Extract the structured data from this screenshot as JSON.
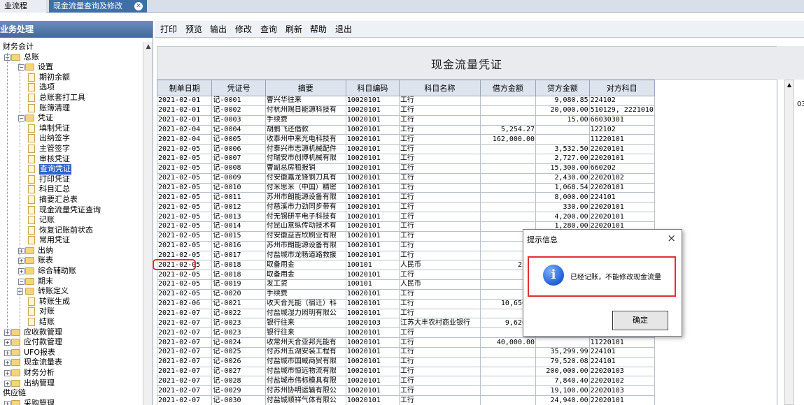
{
  "tabs": [
    {
      "label": "业流程"
    },
    {
      "label": "现金流量查询及修改"
    }
  ],
  "left_panel": {
    "title": "业务处理",
    "tree": [
      {
        "label": "财务会计",
        "level": 0,
        "kind": "text"
      },
      {
        "label": "总账",
        "level": 1,
        "kind": "folder",
        "pm": "-"
      },
      {
        "label": "设置",
        "level": 2,
        "kind": "folder",
        "pm": "-"
      },
      {
        "label": "期初余额",
        "level": 3,
        "kind": "doc"
      },
      {
        "label": "选项",
        "level": 3,
        "kind": "doc"
      },
      {
        "label": "总账套打工具",
        "level": 3,
        "kind": "doc"
      },
      {
        "label": "账簿清理",
        "level": 3,
        "kind": "doc"
      },
      {
        "label": "凭证",
        "level": 2,
        "kind": "folder",
        "pm": "-"
      },
      {
        "label": "填制凭证",
        "level": 3,
        "kind": "doc"
      },
      {
        "label": "出纳签字",
        "level": 3,
        "kind": "doc"
      },
      {
        "label": "主管签字",
        "level": 3,
        "kind": "doc"
      },
      {
        "label": "审核凭证",
        "level": 3,
        "kind": "doc"
      },
      {
        "label": "查询凭证",
        "level": 3,
        "kind": "doc",
        "selected": true
      },
      {
        "label": "打印凭证",
        "level": 3,
        "kind": "doc"
      },
      {
        "label": "科目汇总",
        "level": 3,
        "kind": "doc"
      },
      {
        "label": "摘要汇总表",
        "level": 3,
        "kind": "doc"
      },
      {
        "label": "现金流量凭证查询",
        "level": 3,
        "kind": "doc"
      },
      {
        "label": "记账",
        "level": 3,
        "kind": "doc"
      },
      {
        "label": "恢复记账前状态",
        "level": 3,
        "kind": "doc"
      },
      {
        "label": "常用凭证",
        "level": 3,
        "kind": "doc"
      },
      {
        "label": "出纳",
        "level": 2,
        "kind": "folder",
        "pm": "+"
      },
      {
        "label": "账表",
        "level": 2,
        "kind": "folder",
        "pm": "+"
      },
      {
        "label": "综合辅助账",
        "level": 2,
        "kind": "folder",
        "pm": "+"
      },
      {
        "label": "期末",
        "level": 2,
        "kind": "folder",
        "pm": "-"
      },
      {
        "label": "转账定义",
        "level": 3,
        "kind": "folder",
        "pm": "+"
      },
      {
        "label": "转账生成",
        "level": 3,
        "kind": "doc"
      },
      {
        "label": "对账",
        "level": 3,
        "kind": "doc"
      },
      {
        "label": "结账",
        "level": 3,
        "kind": "doc"
      },
      {
        "label": "应收款管理",
        "level": 1,
        "kind": "folder",
        "pm": "+"
      },
      {
        "label": "应付款管理",
        "level": 1,
        "kind": "folder",
        "pm": "+"
      },
      {
        "label": "UFO报表",
        "level": 1,
        "kind": "folder",
        "pm": "+"
      },
      {
        "label": "现金流量表",
        "level": 1,
        "kind": "folder",
        "pm": "+"
      },
      {
        "label": "财务分析",
        "level": 1,
        "kind": "folder",
        "pm": "+"
      },
      {
        "label": "出纳管理",
        "level": 1,
        "kind": "folder",
        "pm": "+"
      },
      {
        "label": "供应链",
        "level": 0,
        "kind": "text"
      },
      {
        "label": "采购管理",
        "level": 1,
        "kind": "folder",
        "pm": "+"
      }
    ]
  },
  "toolbar": [
    {
      "label": "打印"
    },
    {
      "label": "预览"
    },
    {
      "label": "输出"
    },
    {
      "label": "修改"
    },
    {
      "label": "查询"
    },
    {
      "label": "刷新"
    },
    {
      "label": "帮助"
    },
    {
      "label": "退出"
    }
  ],
  "document": {
    "title": "现金流量凭证"
  },
  "table": {
    "columns": [
      "制单日期",
      "凭证号",
      "摘要",
      "科目编码",
      "科目名称",
      "借方金额",
      "贷方金额",
      "对方科目"
    ],
    "rows": [
      [
        "2021-02-01",
        "记-0001",
        "曹兴华往来",
        "10020101",
        "工行",
        "",
        "9,080.85",
        "224102"
      ],
      [
        "2021-02-01",
        "记-0002",
        "付杭州赐日能源科技有",
        "10020101",
        "工行",
        "",
        "20,000.00",
        "510129, 2221010"
      ],
      [
        "2021-02-01",
        "记-0003",
        "手续费",
        "10020101",
        "工行",
        "",
        "15.00",
        "66030301"
      ],
      [
        "2021-02-04",
        "记-0004",
        "胡鹏飞还借款",
        "10020101",
        "工行",
        "5,254.27",
        "",
        "122102"
      ],
      [
        "2021-02-04",
        "记-0005",
        "收泰州中来光电科技有",
        "10020101",
        "工行",
        "162,000.00",
        "",
        "11220101"
      ],
      [
        "2021-02-05",
        "记-0006",
        "付泰兴市志源机械配件",
        "10020101",
        "工行",
        "",
        "3,532.50",
        "22020101"
      ],
      [
        "2021-02-05",
        "记-0007",
        "付瑞安市创博机械有限",
        "10020101",
        "工行",
        "",
        "2,727.00",
        "22020101"
      ],
      [
        "2021-02-05",
        "记-0008",
        "曹副总房租报销",
        "10020101",
        "工行",
        "",
        "15,300.00",
        "660202"
      ],
      [
        "2021-02-05",
        "记-0009",
        "付安徽嘉龙锋钢刀具有",
        "10020101",
        "工行",
        "",
        "2,430.00",
        "22020102"
      ],
      [
        "2021-02-05",
        "记-0010",
        "付米思米（中国）精密",
        "10020101",
        "工行",
        "",
        "1,068.54",
        "22020101"
      ],
      [
        "2021-02-05",
        "记-0011",
        "苏州市朗能源设备有限",
        "10020101",
        "工行",
        "",
        "8,000.00",
        "224101"
      ],
      [
        "2021-02-05",
        "记-0012",
        "付慈溪市力劲同步带有",
        "10020101",
        "工行",
        "",
        "330.00",
        "22020101"
      ],
      [
        "2021-02-05",
        "记-0013",
        "付无锡研平电子科技有",
        "10020101",
        "工行",
        "",
        "4,200.00",
        "22020101"
      ],
      [
        "2021-02-05",
        "记-0014",
        "付昆山意纵传动技术有",
        "10020101",
        "工行",
        "",
        "1,280.00",
        "22020101"
      ],
      [
        "2021-02-05",
        "记-0015",
        "付安徽益吉欣刷业有限",
        "10020101",
        "工行",
        "",
        "",
        ""
      ],
      [
        "2021-02-05",
        "记-0016",
        "苏州市朗能源设备有限",
        "10020101",
        "工行",
        "",
        "",
        ""
      ],
      [
        "2021-02-05",
        "记-0017",
        "付盐城市龙畅道路救援",
        "10020101",
        "工行",
        "",
        "",
        ""
      ],
      [
        "2021-02-05",
        "记-0018",
        "取备用金",
        "100101",
        "人民币",
        "25,0",
        "",
        ""
      ],
      [
        "2021-02-05",
        "记-0018",
        "取备用金",
        "10020101",
        "工行",
        "",
        "",
        ""
      ],
      [
        "2021-02-05",
        "记-0019",
        "发工资",
        "100101",
        "人民币",
        "",
        "",
        ""
      ],
      [
        "2021-02-05",
        "记-0020",
        "手续费",
        "10020101",
        "工行",
        "",
        "",
        ""
      ],
      [
        "2021-02-06",
        "记-0021",
        "收天合光能（宿迁）科",
        "10020101",
        "工行",
        "10,650.0",
        "",
        ""
      ],
      [
        "2021-02-07",
        "记-0022",
        "付盐城湿力照明有限公",
        "10020101",
        "工行",
        "",
        "",
        ""
      ],
      [
        "2021-02-07",
        "记-0023",
        "银行往来",
        "10020103",
        "江苏大丰农村商业银行",
        "9,626.0",
        "",
        ""
      ],
      [
        "2021-02-07",
        "记-0023",
        "银行往来",
        "10020101",
        "工行",
        "",
        "",
        ""
      ],
      [
        "2021-02-07",
        "记-0024",
        "收常州天合亚邦光能有",
        "10020101",
        "工行",
        "40,000.00",
        "",
        "11220101"
      ],
      [
        "2021-02-07",
        "记-0025",
        "付苏州五湖安装工程有",
        "10020101",
        "工行",
        "",
        "35,299.99",
        "224101"
      ],
      [
        "2021-02-07",
        "记-0026",
        "付盐城市国威商贸有限",
        "10020101",
        "工行",
        "",
        "79,520.08",
        "224101"
      ],
      [
        "2021-02-07",
        "记-0027",
        "付盐城市恒远物流有限",
        "10020101",
        "工行",
        "",
        "200,000.00",
        "22020103"
      ],
      [
        "2021-02-07",
        "记-0028",
        "付盐城市伟标模具有限",
        "10020101",
        "工行",
        "",
        "7,840.40",
        "22020102"
      ],
      [
        "2021-02-07",
        "记-0029",
        "付苏州协明运输有限公",
        "10020101",
        "工行",
        "",
        "19,100.00",
        "22020103"
      ],
      [
        "2021-02-07",
        "记-0030",
        "付盐城顺祥气体有限公",
        "10020101",
        "工行",
        "",
        "24,940.00",
        "22020101"
      ]
    ]
  },
  "right_fragment": "03",
  "dialog": {
    "title": "提示信息",
    "close": "×",
    "message": "已经记账，不能修改现金流量",
    "ok_label": "确定"
  }
}
